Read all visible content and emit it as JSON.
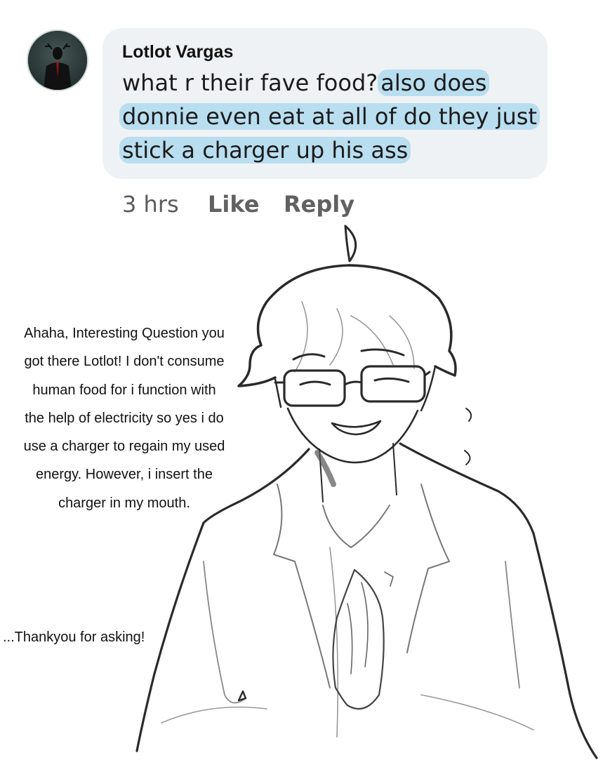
{
  "comment": {
    "author": "Lotlot Vargas",
    "line1_plain": "what r their fave food?",
    "line1_highlight": "also does",
    "line2_highlight": "donnie even eat at all of do they just",
    "line3_highlight": "stick a charger up his ass",
    "time": "3 hrs",
    "like_label": "Like",
    "reply_label": "Reply"
  },
  "answer": {
    "lines": [
      "Ahaha, Interesting Question you",
      "got there Lotlot! I don't consume",
      "human food for i function with",
      "the help of electricity so yes i do",
      "use a charger to regain my used",
      "energy. However, i insert the",
      "charger in my mouth."
    ],
    "thanks": "...Thankyou for asking!"
  },
  "colors": {
    "bubble": "#eff2f4",
    "highlight": "#b9def0",
    "meta_text": "#5b5b5b",
    "sketch_line": "#2a2a2a"
  },
  "icons": {
    "avatar": "profile-avatar"
  }
}
